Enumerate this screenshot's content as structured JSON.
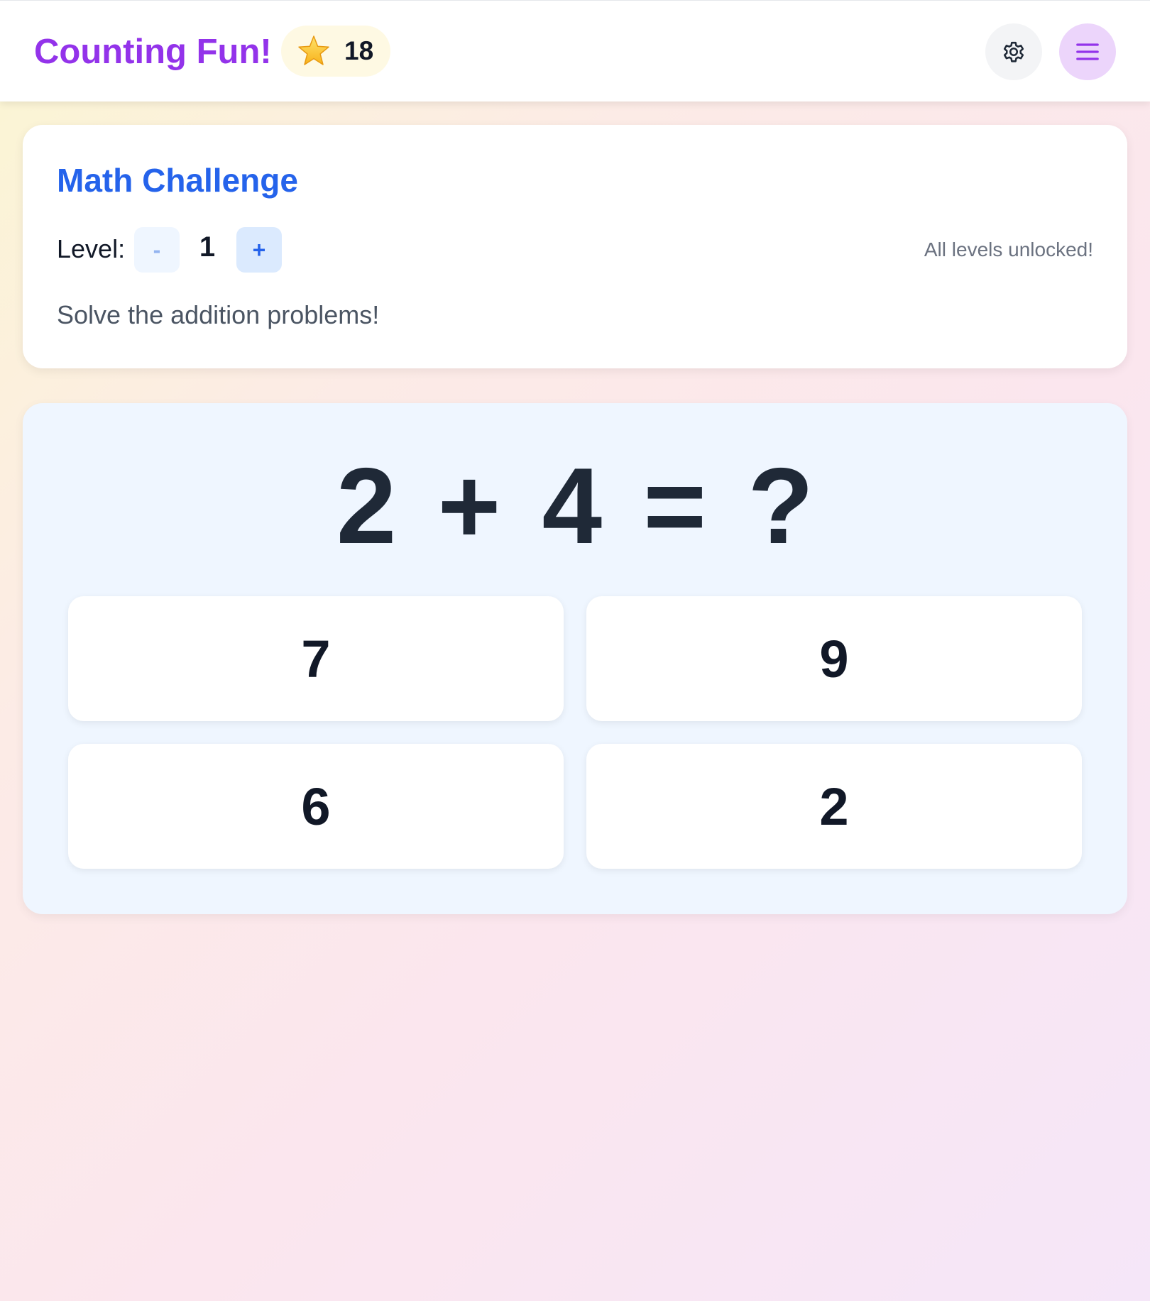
{
  "header": {
    "title": "Counting Fun!",
    "stars": "18"
  },
  "challenge": {
    "title": "Math Challenge",
    "level_label": "Level:",
    "level_minus": "-",
    "level_value": "1",
    "level_plus": "+",
    "unlock_note": "All levels unlocked!",
    "instructions": "Solve the addition problems!"
  },
  "problem": {
    "equation": "2 + 4 = ?",
    "answers": [
      "7",
      "9",
      "6",
      "2"
    ]
  },
  "icons": {
    "star": "star-icon",
    "settings": "gear-icon",
    "menu": "hamburger-menu-icon"
  },
  "colors": {
    "brand": "#9333ea",
    "accent": "#2563eb",
    "star_badge_bg": "#fef9e3",
    "menu_button_bg": "#ecd5fb",
    "problem_card_bg": "#eff6ff"
  }
}
